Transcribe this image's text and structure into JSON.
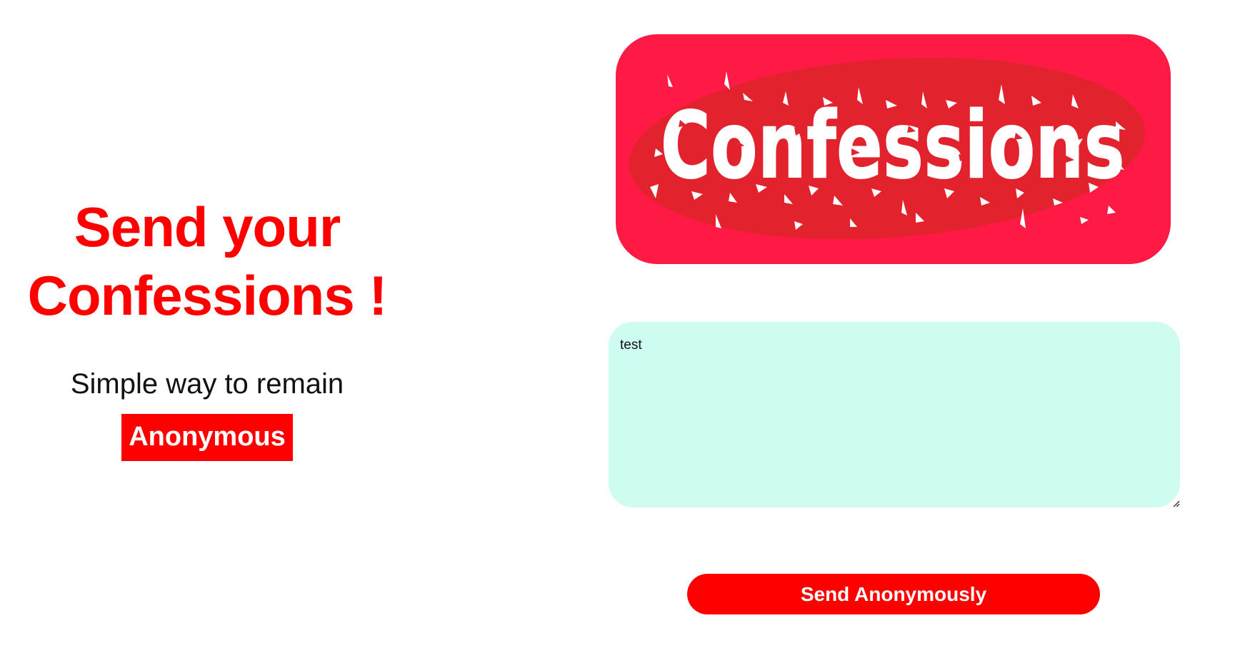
{
  "hero": {
    "title_line1": "Send your",
    "title_line2": "Confessions !",
    "subtitle": "Simple way to remain",
    "badge": "Anonymous"
  },
  "logo": {
    "text": "Confessions",
    "icon": "confessions-logo-icon"
  },
  "form": {
    "message_value": "test",
    "submit_label": "Send Anonymously"
  },
  "colors": {
    "accent": "#ff0000",
    "logo_background": "#ff1a46",
    "logo_blob": "#e2222c",
    "textarea_background": "#cffcf1",
    "text": "#111111"
  }
}
